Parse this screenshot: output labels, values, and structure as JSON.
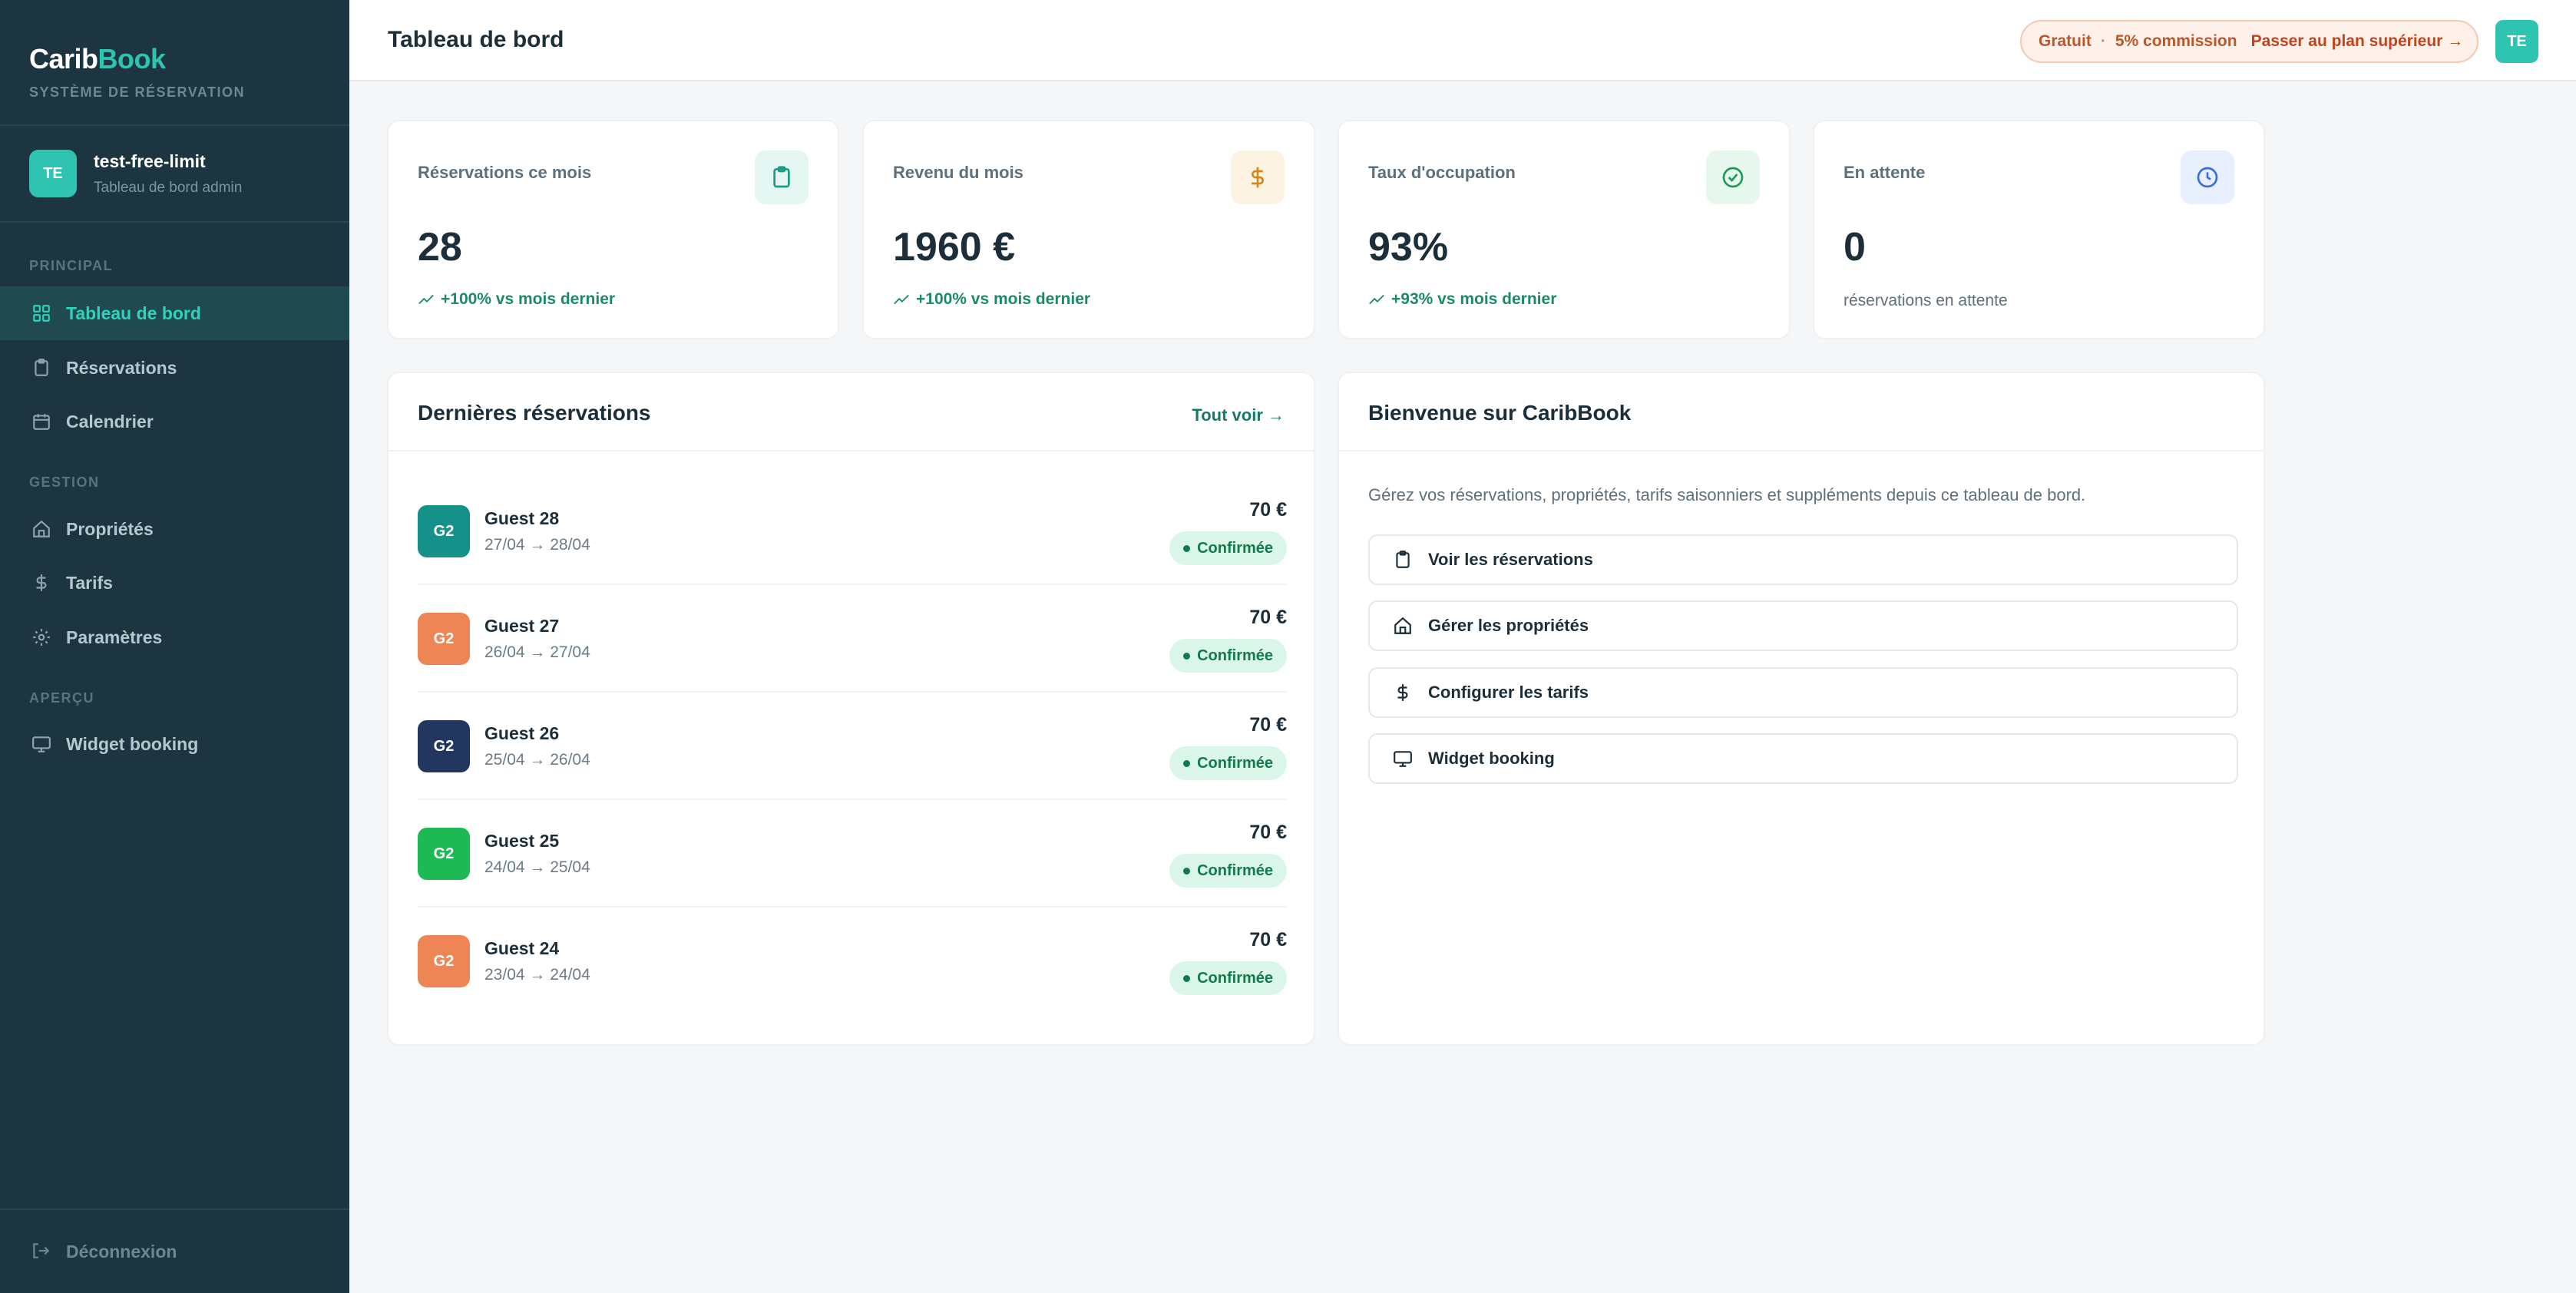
{
  "brand": {
    "name_part1": "Carib",
    "name_part2": "Book",
    "subtitle": "SYSTÈME DE RÉSERVATION"
  },
  "user": {
    "initials": "TE",
    "name": "test-free-limit",
    "role": "Tableau de bord admin"
  },
  "nav": {
    "sections": {
      "principal": "PRINCIPAL",
      "gestion": "GESTION",
      "apercu": "APERÇU"
    },
    "items": [
      {
        "label": "Tableau de bord",
        "icon": "grid-icon",
        "active": true
      },
      {
        "label": "Réservations",
        "icon": "clipboard-icon"
      },
      {
        "label": "Calendrier",
        "icon": "calendar-icon"
      },
      {
        "label": "Propriétés",
        "icon": "home-icon"
      },
      {
        "label": "Tarifs",
        "icon": "dollar-icon"
      },
      {
        "label": "Paramètres",
        "icon": "gear-icon"
      },
      {
        "label": "Widget booking",
        "icon": "monitor-icon"
      }
    ],
    "logout": "Déconnexion"
  },
  "header": {
    "title": "Tableau de bord",
    "plan": "Gratuit",
    "separator": "·",
    "commission": "5% commission",
    "upgrade": "Passer au plan supérieur →",
    "avatar": "TE"
  },
  "stats": [
    {
      "label": "Réservations ce mois",
      "value": "28",
      "trend": "+100% vs mois dernier",
      "icon": "clipboard-icon",
      "icon_bg": "#e3f6f2",
      "icon_color": "#1a9c85"
    },
    {
      "label": "Revenu du mois",
      "value": "1960 €",
      "trend": "+100% vs mois dernier",
      "icon": "dollar-icon",
      "icon_bg": "#fdf3e2",
      "icon_color": "#d08a1f"
    },
    {
      "label": "Taux d'occupation",
      "value": "93%",
      "trend": "+93% vs mois dernier",
      "icon": "check-circle-icon",
      "icon_bg": "#e6f7ee",
      "icon_color": "#1e9a59"
    },
    {
      "label": "En attente",
      "value": "0",
      "note": "réservations en attente",
      "icon": "clock-icon",
      "icon_bg": "#e8f0fd",
      "icon_color": "#3a6fd8"
    }
  ],
  "latest": {
    "title": "Dernières réservations",
    "see_all": "Tout voir →",
    "rows": [
      {
        "initials": "G2",
        "name": "Guest 28",
        "dates": "27/04 → 28/04",
        "price": "70 €",
        "status": "Confirmée",
        "color": "#15918a"
      },
      {
        "initials": "G2",
        "name": "Guest 27",
        "dates": "26/04 → 27/04",
        "price": "70 €",
        "status": "Confirmée",
        "color": "#ee8555"
      },
      {
        "initials": "G2",
        "name": "Guest 26",
        "dates": "25/04 → 26/04",
        "price": "70 €",
        "status": "Confirmée",
        "color": "#223660"
      },
      {
        "initials": "G2",
        "name": "Guest 25",
        "dates": "24/04 → 25/04",
        "price": "70 €",
        "status": "Confirmée",
        "color": "#1db954"
      },
      {
        "initials": "G2",
        "name": "Guest 24",
        "dates": "23/04 → 24/04",
        "price": "70 €",
        "status": "Confirmée",
        "color": "#ee8555"
      }
    ]
  },
  "welcome": {
    "title": "Bienvenue sur CaribBook",
    "text": "Gérez vos réservations, propriétés, tarifs saisonniers et suppléments depuis ce tableau de bord.",
    "actions": [
      {
        "label": "Voir les réservations",
        "icon": "clipboard-icon"
      },
      {
        "label": "Gérer les propriétés",
        "icon": "home-icon"
      },
      {
        "label": "Configurer les tarifs",
        "icon": "dollar-icon"
      },
      {
        "label": "Widget booking",
        "icon": "monitor-icon"
      }
    ]
  }
}
